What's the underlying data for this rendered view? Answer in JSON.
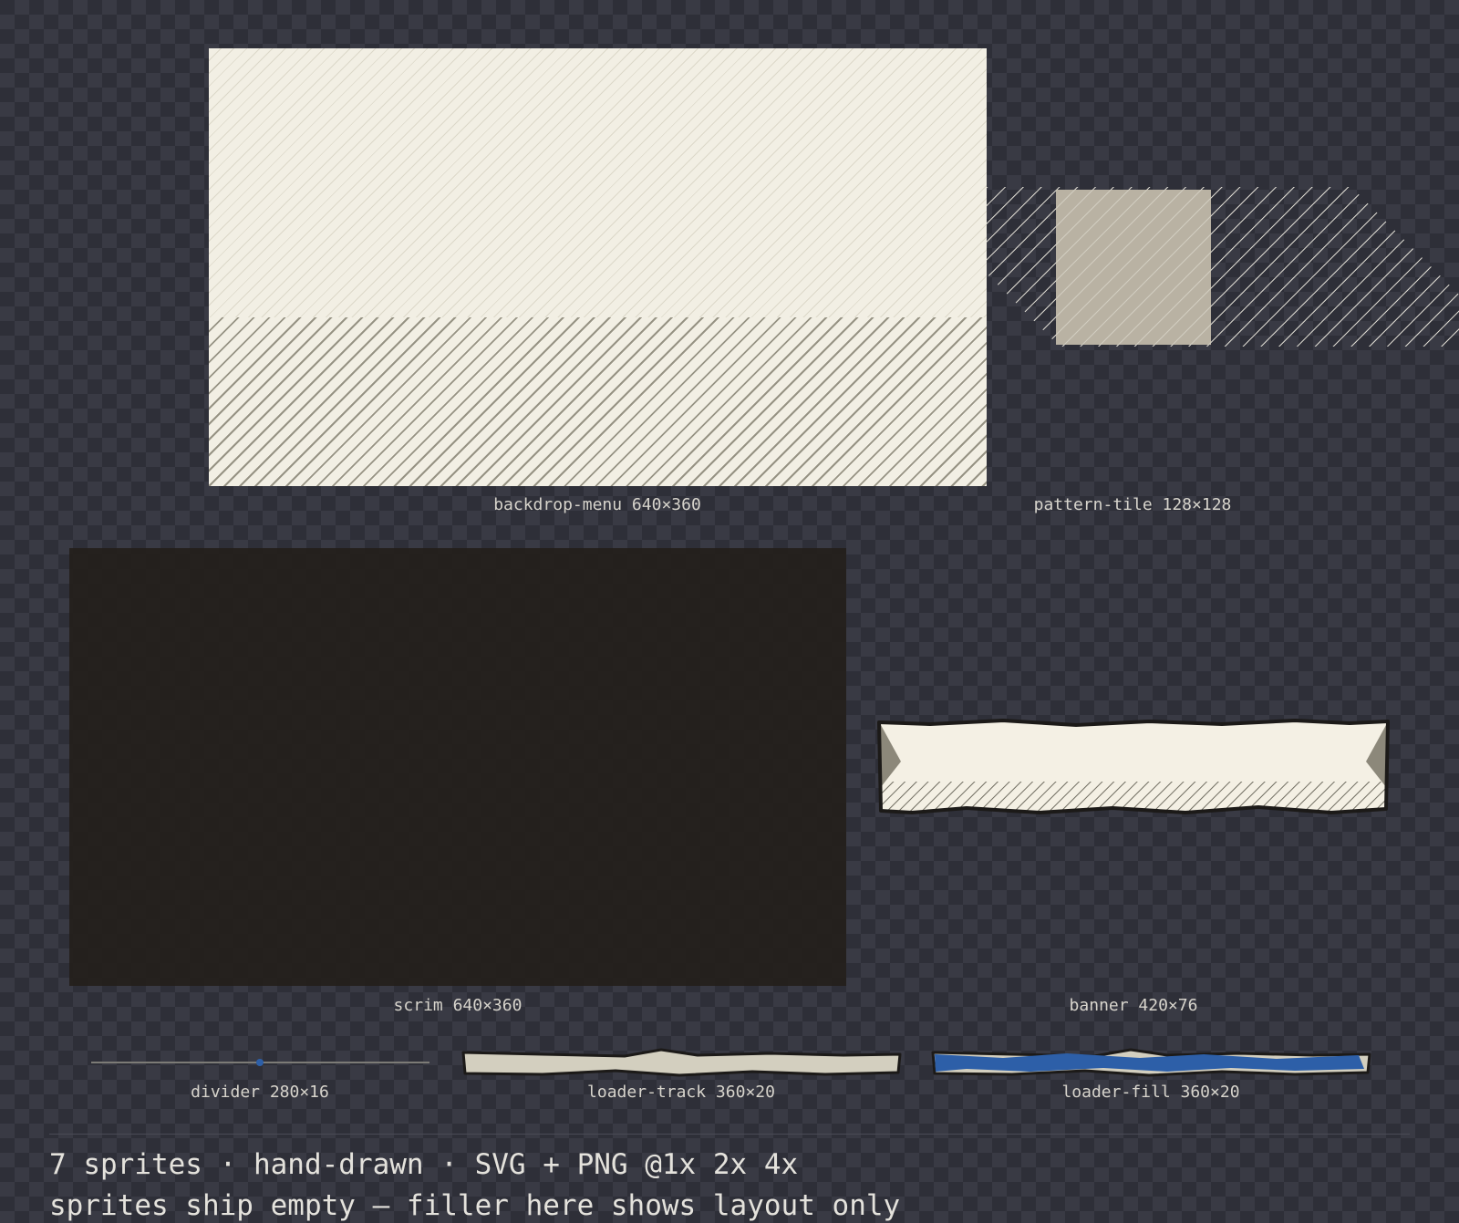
{
  "sprites": [
    {
      "name": "backdrop-menu",
      "size": "640×360",
      "label": "backdrop-menu 640×360"
    },
    {
      "name": "pattern-tile",
      "size": "128×128",
      "label": "pattern-tile 128×128"
    },
    {
      "name": "scrim",
      "size": "640×360",
      "label": "scrim 640×360"
    },
    {
      "name": "banner",
      "size": "420×76",
      "label": "banner 420×76"
    },
    {
      "name": "divider",
      "size": "280×16",
      "label": "divider 280×16"
    },
    {
      "name": "loader-track",
      "size": "360×20",
      "label": "loader-track 360×20"
    },
    {
      "name": "loader-fill",
      "size": "360×20",
      "label": "loader-fill 360×20"
    }
  ],
  "footer": {
    "summary": "7 sprites · hand-drawn · SVG + PNG @1x 2x 4x",
    "note": "sprites ship empty — filler here shows layout only"
  },
  "colors": {
    "background": "#2e2f38",
    "paper": "#f2efe4",
    "scrim": "#24201c",
    "track": "#d3cfbf",
    "fill": "#2d5fa8",
    "outline": "#1c1a18"
  }
}
